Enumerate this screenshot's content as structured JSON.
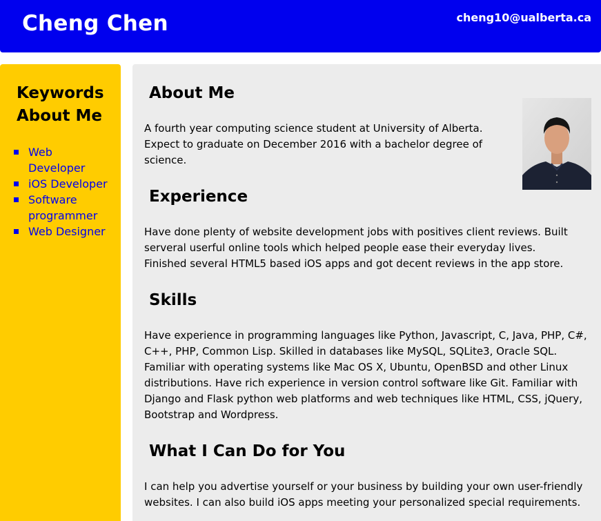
{
  "header": {
    "name": "Cheng Chen",
    "email": "cheng10@ualberta.ca"
  },
  "sidebar": {
    "title": "Keywords About Me",
    "items": [
      {
        "label": "Web Developer"
      },
      {
        "label": "iOS Developer"
      },
      {
        "label": "Software programmer"
      },
      {
        "label": "Web Designer"
      }
    ]
  },
  "main": {
    "sections": [
      {
        "heading": "About Me",
        "text": "A fourth year computing science student at University of Alberta. Expect to graduate on December 2016 with a bachelor degree of science."
      },
      {
        "heading": "Experience",
        "text": "Have done plenty of website development jobs with positives client reviews. Built serveral userful online tools which helped people ease their everyday lives. Finished several HTML5 based iOS apps and got decent reviews in the app store."
      },
      {
        "heading": "Skills",
        "text": "Have experience in programming languages like Python, Javascript, C, Java, PHP, C#, C++, PHP, Common Lisp. Skilled in databases like MySQL, SQLite3, Oracle SQL. Familiar with operating systems like Mac OS X, Ubuntu, OpenBSD and other Linux distributions. Have rich experience in version control software like Git. Familiar with Django and Flask python web platforms and web techniques like HTML, CSS, jQuery, Bootstrap and Wordpress."
      },
      {
        "heading": "What I Can Do for You",
        "text": "I can help you advertise yourself or your business by building your own user-friendly websites. I can also build iOS apps meeting your personalized special requirements."
      }
    ]
  },
  "colors": {
    "header_bg": "#0000ee",
    "sidebar_bg": "#ffcc00",
    "main_bg": "#ececec",
    "link": "#0000ee"
  }
}
